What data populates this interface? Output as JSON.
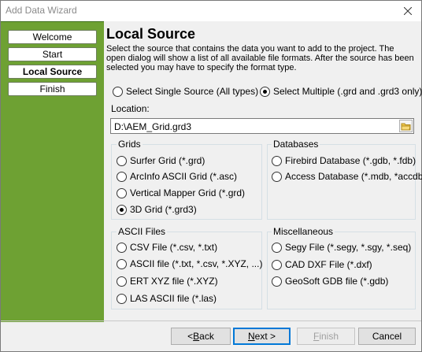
{
  "window": {
    "title": "Add Data Wizard"
  },
  "sidebar": {
    "items": [
      {
        "label": "Welcome",
        "active": false
      },
      {
        "label": "Start",
        "active": false
      },
      {
        "label": "Local Source",
        "active": true
      },
      {
        "label": "Finish",
        "active": false
      }
    ]
  },
  "main": {
    "heading": "Local Source",
    "description": "Select the source that contains the data you want to add to the project.  The open dialog will show a list of all available file formats. After the source has been selected you may have to specify the format type.",
    "source_mode": {
      "single_label": "Select Single Source (All types)",
      "multiple_label": "Select Multiple (.grd and .grd3 only)",
      "selected": "multiple"
    },
    "location": {
      "label": "Location:",
      "value": "D:\\AEM_Grid.grd3"
    },
    "groups": {
      "grids": {
        "title": "Grids",
        "options": [
          "Surfer Grid (*.grd)",
          "ArcInfo ASCII Grid (*.asc)",
          "Vertical Mapper Grid (*.grd)",
          "3D Grid (*.grd3)"
        ],
        "selected": "3D Grid (*.grd3)"
      },
      "databases": {
        "title": "Databases",
        "options": [
          "Firebird Database (*.gdb, *.fdb)",
          "Access Database (*.mdb, *accdb)"
        ]
      },
      "ascii": {
        "title": "ASCII Files",
        "options": [
          "CSV File (*.csv, *.txt)",
          "ASCII file (*.txt, *.csv, *.XYZ, ...)",
          "ERT XYZ file (*.XYZ)",
          "LAS ASCII file (*.las)"
        ]
      },
      "misc": {
        "title": "Miscellaneous",
        "options": [
          "Segy File (*.segy, *.sgy, *.seq)",
          "CAD DXF File (*.dxf)",
          "GeoSoft GDB file (*.gdb)"
        ]
      }
    }
  },
  "footer": {
    "back_prefix": "< ",
    "back_mnemonic": "B",
    "back_rest": "ack",
    "next_mnemonic": "N",
    "next_rest": "ext >",
    "finish_mnemonic": "F",
    "finish_rest": "inish",
    "cancel": "Cancel"
  },
  "colors": {
    "sidebar": "#6ea133",
    "default_button_border": "#0078d7"
  },
  "icons": {
    "close": "close-icon",
    "browse": "folder-icon"
  }
}
